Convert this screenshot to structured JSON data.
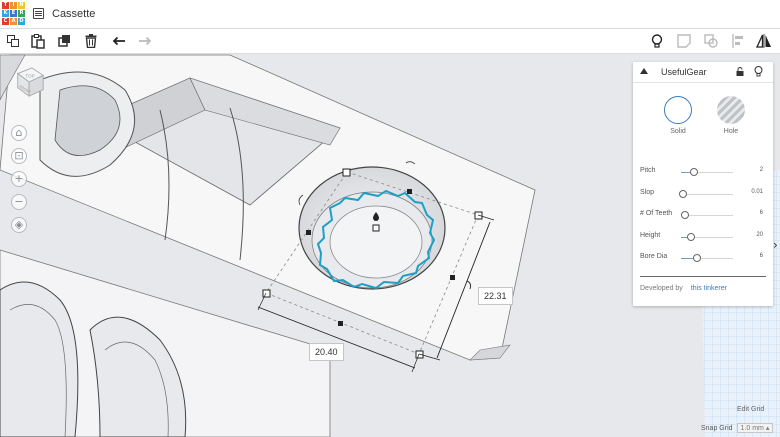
{
  "app": {
    "logo_letters": [
      "T",
      "I",
      "N",
      "K",
      "E",
      "R",
      "C",
      "A",
      "D"
    ],
    "logo_colors": [
      "#e23a2f",
      "#f0932a",
      "#f4c133",
      "#2fa6dc",
      "#3c78c3",
      "#39a856",
      "#e23a2f",
      "#f0932a",
      "#2fa6dc"
    ],
    "title": "Cassette"
  },
  "toolbar": {
    "copy_icon": "copy-icon",
    "paste_icon": "paste-icon",
    "duplicate_icon": "duplicate-icon",
    "delete_icon": "trash-icon",
    "undo_icon": "undo-arrow-icon",
    "redo_icon": "redo-arrow-icon",
    "right_icons": [
      "bulb-icon",
      "note-icon",
      "group-icon",
      "align-icon",
      "mirror-icon"
    ]
  },
  "viewcube": {
    "top_label": "TOP",
    "front_label": "FRONT"
  },
  "dimensions": {
    "width": "20.40",
    "depth": "22.31"
  },
  "panel": {
    "name": "UsefulGear",
    "solid_label": "Solid",
    "hole_label": "Hole",
    "params": [
      {
        "label": "Pitch",
        "value": "2",
        "level": 0.25
      },
      {
        "label": "Slop",
        "value": "0.01",
        "level": 0.02
      },
      {
        "label": "# Of Teeth",
        "value": "6",
        "level": 0.05
      },
      {
        "label": "Height",
        "value": "20",
        "level": 0.15
      },
      {
        "label": "Bore Dia",
        "value": "6",
        "level": 0.22
      }
    ],
    "footer_label": "Developed by",
    "footer_link": "this tinkerer"
  },
  "workplane": {
    "edit_grid": "Edit Grid",
    "snap_label": "Snap Grid",
    "snap_value": "1.0 mm ▴"
  },
  "colors": {
    "accent": "#3b7bbf",
    "gear_tooth": "#1ea0c6"
  }
}
